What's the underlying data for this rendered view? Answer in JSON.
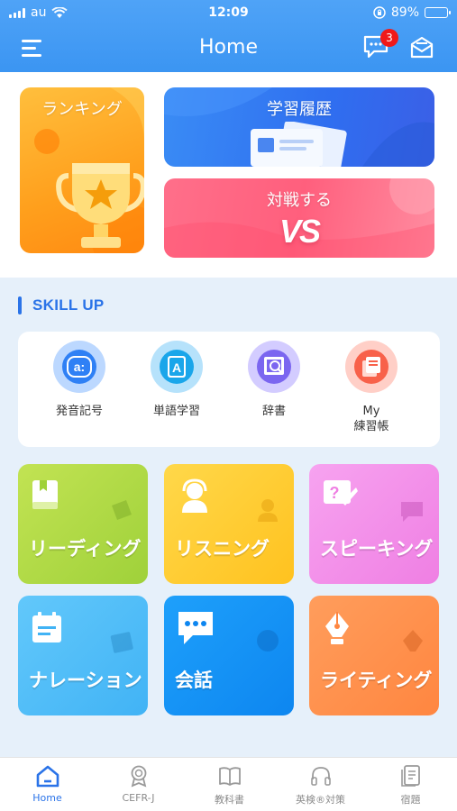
{
  "status_bar": {
    "carrier": "au",
    "time": "12:09",
    "battery": "89%",
    "battery_level": 0.89
  },
  "header": {
    "title": "Home",
    "message_badge": "3"
  },
  "top_cards": {
    "ranking": "ランキング",
    "history": "学習履歴",
    "battle": "対戦する",
    "battle_logo": "VS"
  },
  "skill": {
    "title": "SKILL UP",
    "tools": [
      {
        "label": "発音記号",
        "icon": "pronunciation-icon",
        "glyph": "a:"
      },
      {
        "label": "単語学習",
        "icon": "vocabulary-icon",
        "glyph": "A"
      },
      {
        "label": "辞書",
        "icon": "dictionary-icon"
      },
      {
        "label": "My\n練習帳",
        "icon": "notebook-icon"
      }
    ],
    "tiles": [
      {
        "label": "リーディング",
        "icon": "book-icon"
      },
      {
        "label": "リスニング",
        "icon": "headset-icon"
      },
      {
        "label": "スピーキング",
        "icon": "speech-icon",
        "glyph": "?"
      },
      {
        "label": "ナレーション",
        "icon": "calendar-icon"
      },
      {
        "label": "会話",
        "icon": "chat-icon"
      },
      {
        "label": "ライティング",
        "icon": "pen-icon"
      }
    ]
  },
  "tabbar": {
    "tabs": [
      {
        "label": "Home",
        "icon": "home-icon",
        "active": true
      },
      {
        "label": "CEFR-J",
        "icon": "award-icon"
      },
      {
        "label": "教科書",
        "icon": "textbook-icon"
      },
      {
        "label": "英検®対策",
        "icon": "headphones-icon"
      },
      {
        "label": "宿題",
        "icon": "homework-icon"
      }
    ]
  },
  "colors": {
    "primary": "#3b95f2",
    "accent_text": "#2a73e8",
    "badge": "#f01919"
  }
}
